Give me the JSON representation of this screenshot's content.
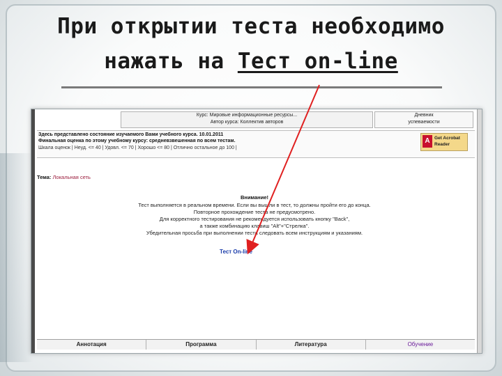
{
  "slide": {
    "title_line1": "При открытии теста необходимо",
    "title_line2_prefix": "нажать на ",
    "title_line2_link": "Тест on-line"
  },
  "screenshot": {
    "header": {
      "course_label": "Курс: Мировые информационные ресурсы...",
      "author_label": "Автор курса: Коллектив авторов"
    },
    "diary": {
      "line1": "Дневник",
      "line2": "успеваемости"
    },
    "info": {
      "line1": "Здесь представлено состояние изучаемого Вами учебного курса. 10.01.2011",
      "line2": "Финальная оценка по этому учебному курсу: средневзвешенная по всем тестам.",
      "line3": "Шкала оценок  | Неуд. <= 40 | Удовл. <= 70 | Хорошо <= 80 | Отлично  остальное до 100 |"
    },
    "acrobat": {
      "logo_glyph": "A",
      "line1": "Get Acrobat",
      "line2": "Reader"
    },
    "topic": {
      "label": "Тема:",
      "name": "Локальная сеть"
    },
    "notice": {
      "title": "Внимание!",
      "line1": "Тест выполняется в реальном времени. Если вы вышли в тест, то должны пройти его до конца.",
      "line2": "Повторное прохождение теста не предусмотрено.",
      "line3": "Для корректного тестирования не рекомендуется использовать кнопку \"Back\",",
      "line4": "а также комбинацию клавиш \"Alt\"+\"Стрелка\".",
      "line5": "Убедительная просьба при выполнении теста следовать всем инструкциям и указаниям."
    },
    "test_link": "Тест On-line",
    "footer_tabs": [
      "Аннотация",
      "Программа",
      "Литература",
      "Обучение"
    ]
  },
  "colors": {
    "accent_arrow": "#e02020",
    "link": "#1a3caa",
    "topic": "#9b1c3c"
  }
}
